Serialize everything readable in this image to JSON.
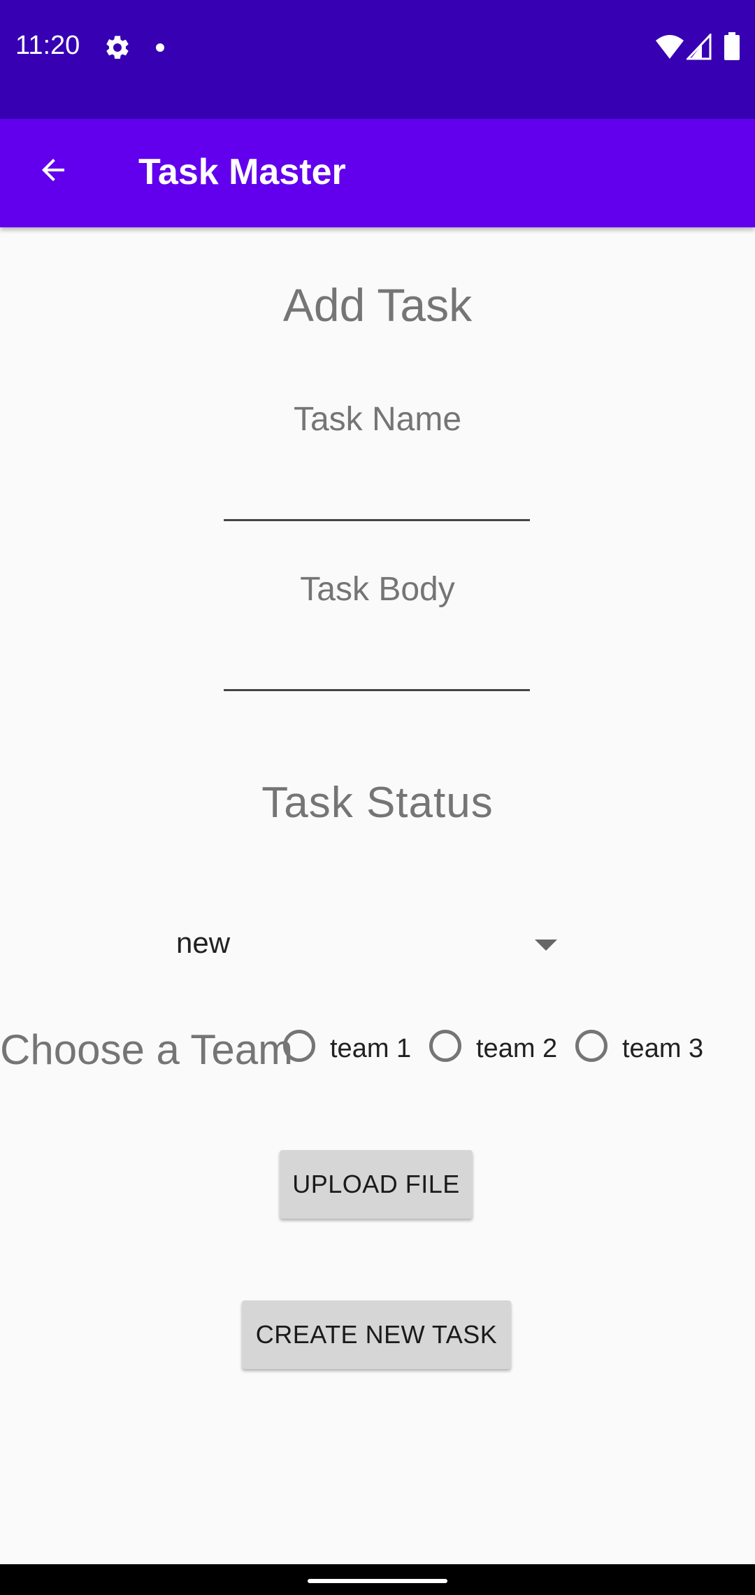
{
  "status_bar": {
    "time": "11:20",
    "icons": [
      "gear-icon",
      "dot-icon",
      "wifi-icon",
      "signal-icon",
      "battery-icon"
    ],
    "background": "#3700b3"
  },
  "app_bar": {
    "title": "Task Master",
    "back_icon": "arrow-back-icon",
    "background": "#6200ee"
  },
  "form": {
    "heading": "Add Task",
    "task_name_label": "Task Name",
    "task_name_value": "",
    "task_body_label": "Task Body",
    "task_body_value": "",
    "status_heading": "Task Status",
    "status_selected": "new",
    "team_label": "Choose a Team",
    "teams": [
      {
        "label": "team 1",
        "checked": false
      },
      {
        "label": "team 2",
        "checked": false
      },
      {
        "label": "team 3",
        "checked": false
      }
    ],
    "upload_button": "UPLOAD FILE",
    "create_button": "CREATE NEW TASK"
  }
}
